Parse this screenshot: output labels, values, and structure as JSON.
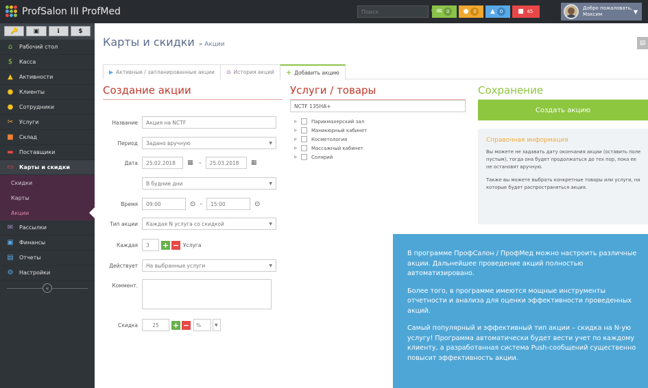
{
  "app": {
    "title": "ProfSalon III ProfMed"
  },
  "topbar": {
    "search_placeholder": "Поиск",
    "badges": [
      {
        "icon": "envelope-icon",
        "count": "0",
        "color": "#8bc34a"
      },
      {
        "icon": "comment-icon",
        "count": "0",
        "color": "#f0a830"
      },
      {
        "icon": "bell-icon",
        "count": "0",
        "color": "#5aa9e6"
      },
      {
        "icon": "gift-icon",
        "count": "45",
        "color": "#e84747"
      }
    ],
    "user_greeting": "Добро пожаловать,",
    "user_name": "Максим"
  },
  "sidebar": {
    "quick_buttons": [
      "🔑",
      "▣",
      "ℹ",
      "$"
    ],
    "items": [
      {
        "label": "Рабочий стол",
        "icon": "home-icon",
        "glyph": "⌂",
        "color": "#8bc34a"
      },
      {
        "label": "Касса",
        "icon": "dollar-icon",
        "glyph": "$",
        "color": "#8bc34a"
      },
      {
        "label": "Активности",
        "icon": "bell-icon",
        "glyph": "▲",
        "color": "#f0c020"
      },
      {
        "label": "Клиенты",
        "icon": "users-icon",
        "glyph": "●",
        "color": "#f0c020"
      },
      {
        "label": "Сотрудники",
        "icon": "user-icon",
        "glyph": "●",
        "color": "#f0c020"
      },
      {
        "label": "Услуги",
        "icon": "scissors-icon",
        "glyph": "✂",
        "color": "#f0a830"
      },
      {
        "label": "Склад",
        "icon": "box-icon",
        "glyph": "■",
        "color": "#f08030"
      },
      {
        "label": "Поставщики",
        "icon": "truck-icon",
        "glyph": "▬",
        "color": "#e84747"
      },
      {
        "label": "Карты и скидки",
        "icon": "card-icon",
        "glyph": "▭",
        "color": "#e84747"
      }
    ],
    "subitems": [
      "Скидки",
      "Карты",
      "Акции"
    ],
    "items_after": [
      {
        "label": "Рассылки",
        "icon": "mail-icon",
        "glyph": "✉",
        "color": "#b090d0"
      },
      {
        "label": "Финансы",
        "icon": "money-icon",
        "glyph": "▣",
        "color": "#5aa9e6"
      },
      {
        "label": "Отчеты",
        "icon": "report-icon",
        "glyph": "▤",
        "color": "#5aa9e6"
      },
      {
        "label": "Настройки",
        "icon": "gears-icon",
        "glyph": "⚙",
        "color": "#5aa9e6"
      }
    ]
  },
  "page": {
    "title": "Карты и скидки",
    "breadcrumb": "» Акции",
    "tabs": [
      {
        "label": "Активные / запланированные акции",
        "icon": "play-icon",
        "glyph": "▶",
        "color": "#5aa9e6"
      },
      {
        "label": "История акций",
        "icon": "history-icon",
        "glyph": "⊙",
        "color": "#9b59b6"
      },
      {
        "label": "Добавить акцию",
        "icon": "plus-icon",
        "glyph": "+",
        "color": "#8bc34a"
      }
    ]
  },
  "form": {
    "title": "Создание акции",
    "title_color": "#c0392b",
    "name_label": "Название",
    "name_value": "Акция на NCTF",
    "period_label": "Период",
    "period_value": "Задано вручную",
    "date_label": "Дата",
    "date_from": "25.02.2018",
    "date_to": "25.03.2018",
    "days_value": "В будние дни",
    "time_label": "Время",
    "time_from": "09:00",
    "time_to": "15:00",
    "type_label": "Тип акции",
    "type_value": "Каждая N услуга со скидкой",
    "every_label": "Каждая",
    "every_value": "3",
    "every_unit": "Услуга",
    "applies_label": "Действует",
    "applies_value": "На выбранные услуги",
    "comment_label": "Коммент.",
    "discount_label": "Скидка",
    "discount_value": "25",
    "discount_unit": "%"
  },
  "services": {
    "title": "Услуги / товары",
    "title_color": "#c0392b",
    "search_value": "NCTF 135HA+",
    "tree": [
      "Парикмахерский зал",
      "Маникюрный кабинет",
      "Косметология",
      "Массажный кабинет",
      "Солярий"
    ]
  },
  "save": {
    "title": "Сохранение",
    "title_color": "#8dc63f",
    "button": "Создать акцию",
    "info_title": "Справочная информация",
    "info_p1": "Вы можете не задавать дату окончания акции (оставить поле пустым), тогда она будет продолжаться до тех пор, пока ее не остановят вручную.",
    "info_p2": "Также вы можете выбрать конкретные товары или услуги, на которые будет распространяться акция."
  },
  "promo": {
    "p1": "В программе ПрофСалон / ПрофМед можно настроить различные акции. Дальнейшее проведение акций полностью автоматизировано.",
    "p2": "Более того, в программе имеются мощные инструменты отчетности и анализа для оценки эффективности проведенных акций.",
    "p3": "Самый популярный и эффективный тип акции – скидка на N-ую услугу! Программа автоматически будет вести учет по каждому клиенту, а разработанная система Push-сообщений существенно повысит эффективность акции."
  }
}
